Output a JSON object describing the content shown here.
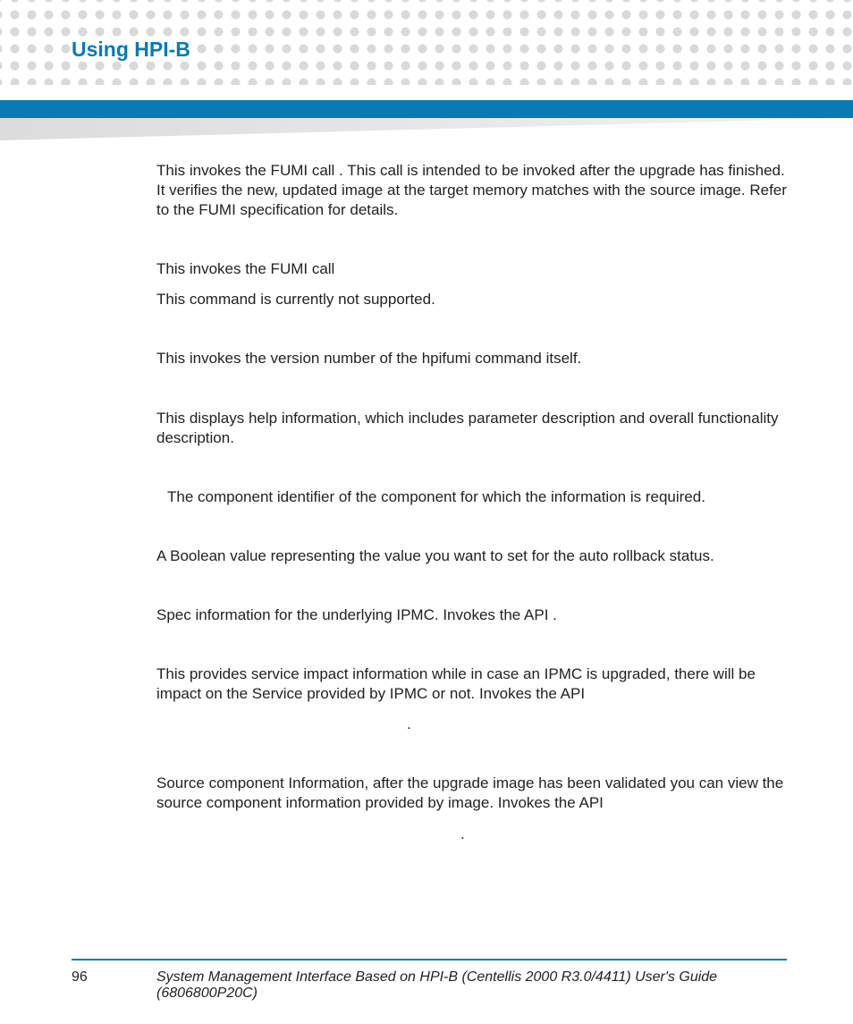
{
  "header": {
    "title": "Using HPI-B"
  },
  "body": {
    "p1": "This invokes the FUMI call                                                      . This call is intended to be invoked after the upgrade has finished. It verifies the new, updated image at the target memory matches with the source image. Refer to the FUMI specification for details.",
    "p2": "This invokes the FUMI call",
    "p3": "This command is currently not supported.",
    "p4": "This invokes the version number of the hpifumi command itself.",
    "p5": "This displays help information, which includes parameter description and overall functionality description.",
    "p6": "The component identifier of the component for which the information is required.",
    "p7": "A Boolean value representing the value you want to set for the auto rollback status.",
    "p8": "Spec information for the underlying IPMC. Invokes the API                                                   .",
    "p9a": "This provides service impact information while in case an IPMC is upgraded, there will be impact on the Service provided by IPMC or not. Invokes the API",
    "p9b": ".",
    "p10a": "Source component Information, after the upgrade image has been validated you can view the source component information provided by image. Invokes the API",
    "p10b": "."
  },
  "footer": {
    "page": "96",
    "text": "System Management Interface Based on HPI-B (Centellis 2000 R3.0/4411) User's Guide (6806800P20C)"
  }
}
